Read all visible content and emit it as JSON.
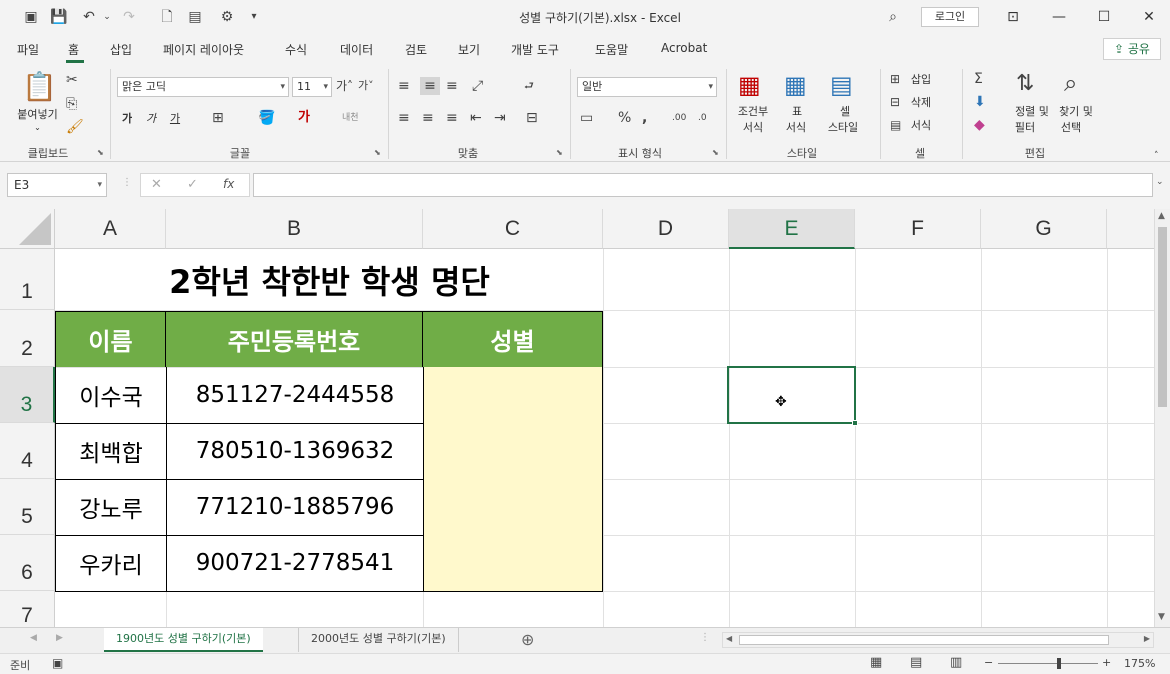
{
  "window": {
    "title": "성별 구하기(기본).xlsx  -  Excel",
    "login_label": "로그인"
  },
  "tabs": [
    "파일",
    "홈",
    "삽입",
    "페이지 레이아웃",
    "수식",
    "데이터",
    "검토",
    "보기",
    "개발 도구",
    "도움말",
    "Acrobat"
  ],
  "share_label": "공유",
  "ribbon": {
    "clipboard": {
      "paste_label": "붙여넣기",
      "group_label": "클립보드"
    },
    "font": {
      "font_name": "맑은 고딕",
      "font_size": "11",
      "bold": "가",
      "italic": "가",
      "underline": "가",
      "group_label": "글꼴"
    },
    "alignment": {
      "group_label": "맞춤"
    },
    "number": {
      "format": "일반",
      "group_label": "표시 형식"
    },
    "styles": {
      "conditional": "조건부",
      "conditional2": "서식",
      "table": "표",
      "table2": "서식",
      "cell": "셀",
      "cell2": "스타일",
      "group_label": "스타일"
    },
    "cells": {
      "insert": "삽입",
      "delete": "삭제",
      "format": "서식",
      "group_label": "셀"
    },
    "editing": {
      "sort": "정렬 및",
      "sort2": "필터",
      "find": "찾기 및",
      "find2": "선택",
      "group_label": "편집"
    }
  },
  "formula_bar": {
    "name_box": "E3",
    "formula": ""
  },
  "grid": {
    "columns": [
      "A",
      "B",
      "C",
      "D",
      "E",
      "F",
      "G"
    ],
    "rows": [
      "1",
      "2",
      "3",
      "4",
      "5",
      "6",
      "7"
    ],
    "selected_cell": "E3",
    "title": "2학년 착한반 학생 명단",
    "headers": [
      "이름",
      "주민등록번호",
      "성별"
    ],
    "records": [
      {
        "name": "이수국",
        "id": "851127-2444558",
        "gender": ""
      },
      {
        "name": "최백합",
        "id": "780510-1369632",
        "gender": ""
      },
      {
        "name": "강노루",
        "id": "771210-1885796",
        "gender": ""
      },
      {
        "name": "우카리",
        "id": "900721-2778541",
        "gender": ""
      }
    ]
  },
  "sheets": [
    "1900년도 성별 구하기(기본)",
    "2000년도 성별 구하기(기본)"
  ],
  "status": {
    "ready": "준비",
    "zoom": "175%"
  },
  "colors": {
    "header_green": "#70ad47",
    "accent": "#217346",
    "input_yellow": "#fff9cc"
  }
}
